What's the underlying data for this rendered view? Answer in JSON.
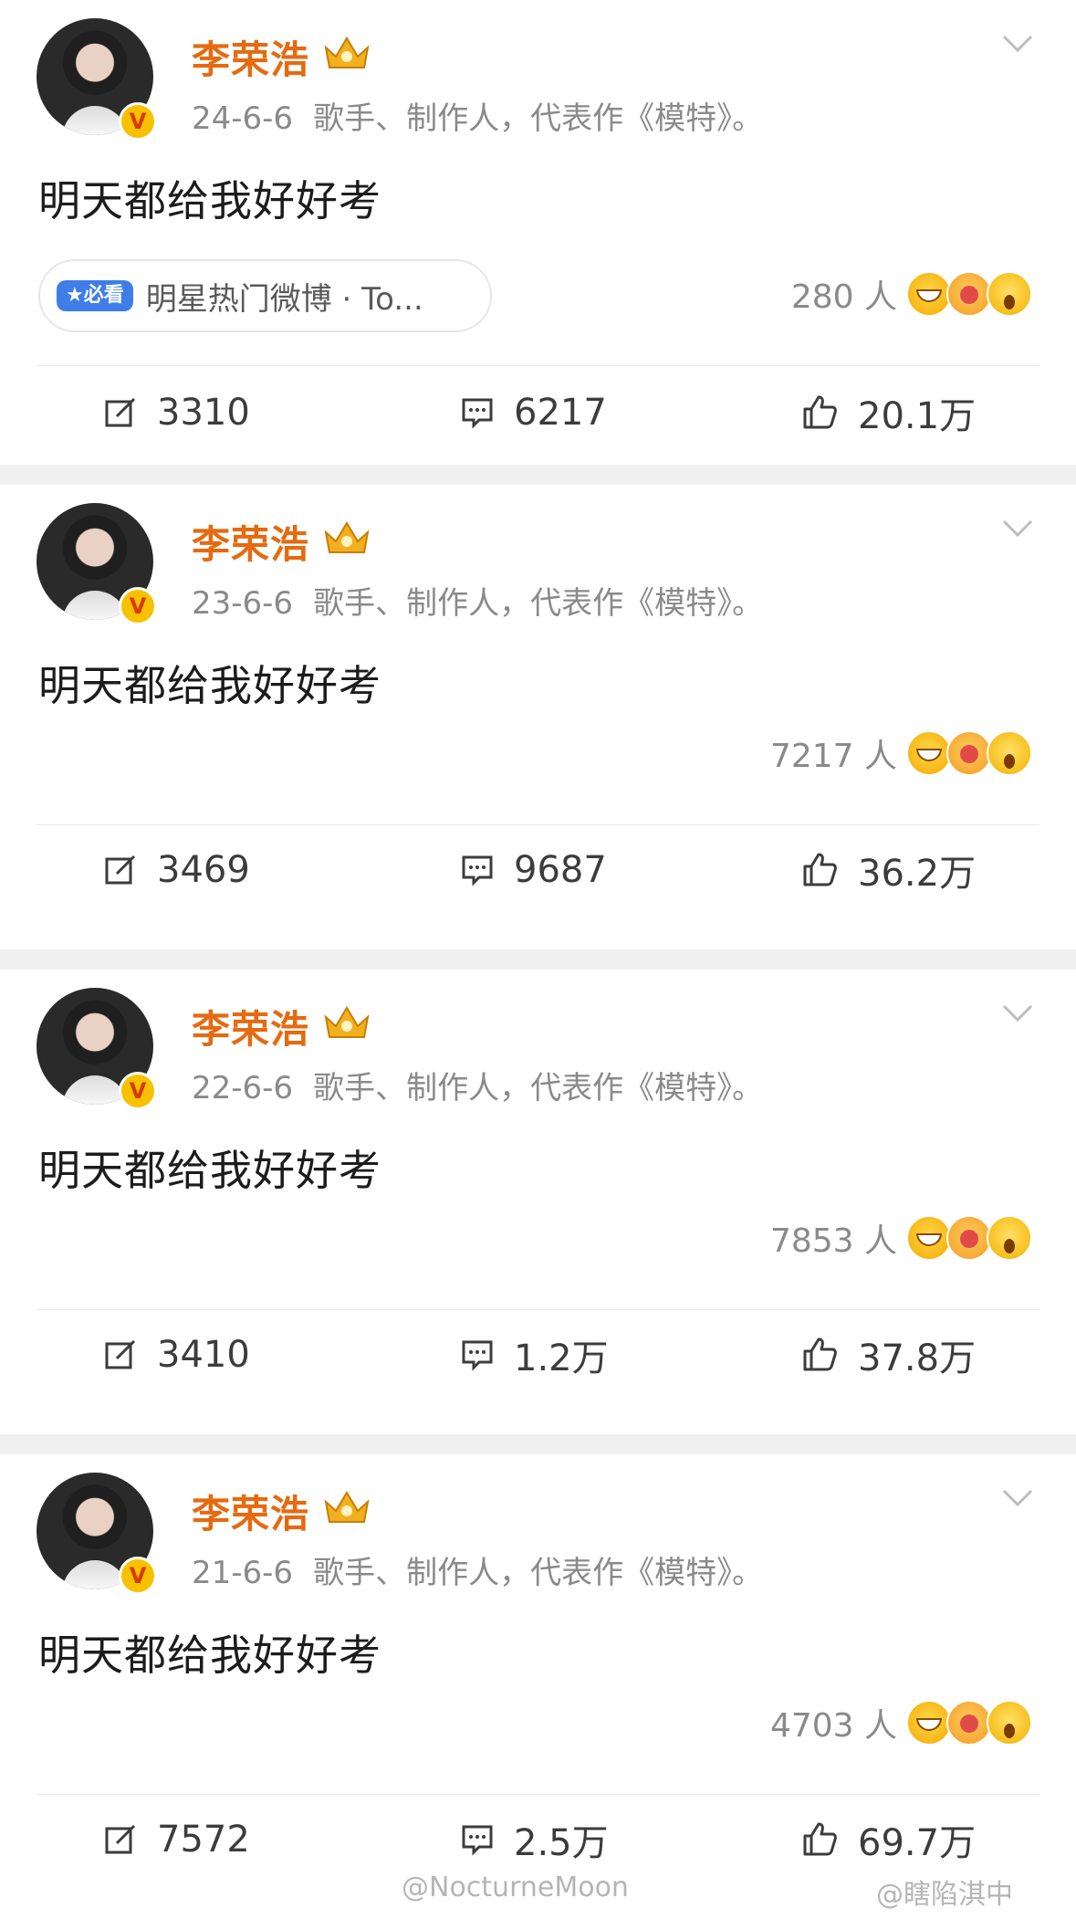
{
  "posts": [
    {
      "author": "李荣浩",
      "date": "24-6-6",
      "bio": "歌手、制作人，代表作《模特》。",
      "content": "明天都给我好好考",
      "tag": {
        "badge": "★必看",
        "text": "明星热门微博 · To..."
      },
      "reaction_count": "280 人",
      "reposts": "3310",
      "comments": "6217",
      "likes": "20.1万"
    },
    {
      "author": "李荣浩",
      "date": "23-6-6",
      "bio": "歌手、制作人，代表作《模特》。",
      "content": "明天都给我好好考",
      "reaction_count": "7217 人",
      "reposts": "3469",
      "comments": "9687",
      "likes": "36.2万"
    },
    {
      "author": "李荣浩",
      "date": "22-6-6",
      "bio": "歌手、制作人，代表作《模特》。",
      "content": "明天都给我好好考",
      "reaction_count": "7853 人",
      "reposts": "3410",
      "comments": "1.2万",
      "likes": "37.8万"
    },
    {
      "author": "李荣浩",
      "date": "21-6-6",
      "bio": "歌手、制作人，代表作《模特》。",
      "content": "明天都给我好好考",
      "reaction_count": "4703 人",
      "reposts": "7572",
      "comments": "2.5万",
      "likes": "69.7万"
    }
  ],
  "watermarks": [
    "@NocturneMoon",
    "@瞎陷淇中"
  ],
  "colors": {
    "author": "#e56a10",
    "meta": "#8a8a8a",
    "badge": "#3f7de8",
    "verified": "#f7c100"
  }
}
